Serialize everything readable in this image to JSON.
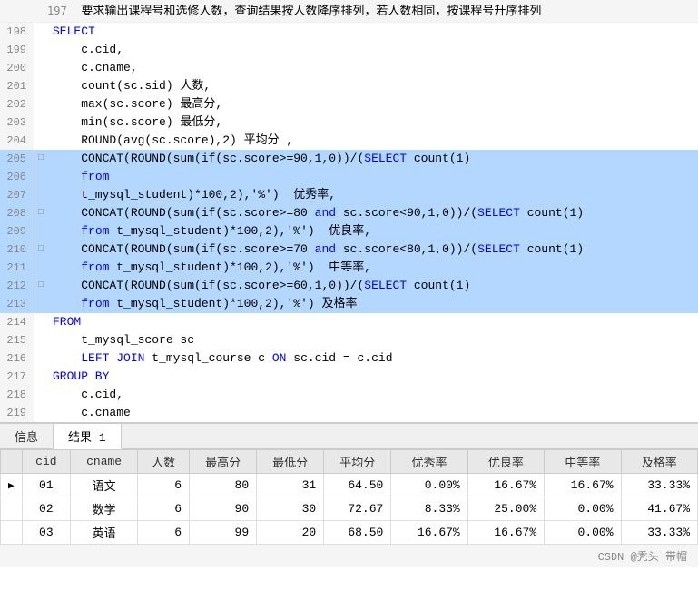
{
  "intro": {
    "text": "要求输出课程号和选修人数，查询结果按人数降序排列，若人数相同，按课程号升序排列",
    "lineNum": "197"
  },
  "codeLines": [
    {
      "num": 198,
      "fold": "",
      "highlighted": false,
      "tokens": [
        {
          "t": "SELECT",
          "c": "kw"
        }
      ]
    },
    {
      "num": 199,
      "fold": "",
      "highlighted": false,
      "tokens": [
        {
          "t": "    c.cid,",
          "c": "plain"
        }
      ]
    },
    {
      "num": 200,
      "fold": "",
      "highlighted": false,
      "tokens": [
        {
          "t": "    c.cname,",
          "c": "plain"
        }
      ]
    },
    {
      "num": 201,
      "fold": "",
      "highlighted": false,
      "tokens": [
        {
          "t": "    count(sc.sid) 人数,",
          "c": "plain"
        }
      ]
    },
    {
      "num": 202,
      "fold": "",
      "highlighted": false,
      "tokens": [
        {
          "t": "    max(sc.score) 最高分,",
          "c": "plain"
        }
      ]
    },
    {
      "num": 203,
      "fold": "",
      "highlighted": false,
      "tokens": [
        {
          "t": "    min(sc.score) 最低分,",
          "c": "plain"
        }
      ]
    },
    {
      "num": 204,
      "fold": "",
      "highlighted": false,
      "tokens": [
        {
          "t": "    ROUND(avg(sc.score),2) 平均分 ,",
          "c": "plain"
        }
      ]
    },
    {
      "num": 205,
      "fold": "□",
      "highlighted": true,
      "tokens": [
        {
          "t": "    CONCAT(ROUND(sum(if(sc.score>=90,1,0))/(",
          "c": "plain"
        },
        {
          "t": "SELECT",
          "c": "kw"
        },
        {
          "t": " count(1)",
          "c": "plain"
        }
      ]
    },
    {
      "num": 206,
      "fold": "",
      "highlighted": true,
      "tokens": [
        {
          "t": "    ",
          "c": "plain"
        },
        {
          "t": "from",
          "c": "kw"
        },
        {
          "t": "",
          "c": "plain"
        }
      ]
    },
    {
      "num": 207,
      "fold": "",
      "highlighted": true,
      "tokens": [
        {
          "t": "    t_mysql_student)*100,2),'%')  优秀率,",
          "c": "plain"
        }
      ]
    },
    {
      "num": 208,
      "fold": "□",
      "highlighted": true,
      "tokens": [
        {
          "t": "    CONCAT(ROUND(sum(if(sc.score>=80 ",
          "c": "plain"
        },
        {
          "t": "and",
          "c": "kw"
        },
        {
          "t": " sc.score<90,1,0))/(",
          "c": "plain"
        },
        {
          "t": "SELECT",
          "c": "kw"
        },
        {
          "t": " count(1)",
          "c": "plain"
        }
      ]
    },
    {
      "num": 209,
      "fold": "",
      "highlighted": true,
      "tokens": [
        {
          "t": "    ",
          "c": "plain"
        },
        {
          "t": "from",
          "c": "kw"
        },
        {
          "t": " t_mysql_student)*100,2),'%')  优良率,",
          "c": "plain"
        }
      ]
    },
    {
      "num": 210,
      "fold": "□",
      "highlighted": true,
      "tokens": [
        {
          "t": "    CONCAT(ROUND(sum(if(sc.score>=70 ",
          "c": "plain"
        },
        {
          "t": "and",
          "c": "kw"
        },
        {
          "t": " sc.score<80,1,0))/(",
          "c": "plain"
        },
        {
          "t": "SELECT",
          "c": "kw"
        },
        {
          "t": " count(1)",
          "c": "plain"
        }
      ]
    },
    {
      "num": 211,
      "fold": "",
      "highlighted": true,
      "tokens": [
        {
          "t": "    ",
          "c": "plain"
        },
        {
          "t": "from",
          "c": "kw"
        },
        {
          "t": " t_mysql_student)*100,2),'%')  中等率,",
          "c": "plain"
        }
      ]
    },
    {
      "num": 212,
      "fold": "□",
      "highlighted": true,
      "tokens": [
        {
          "t": "    CONCAT(ROUND(sum(if(sc.score>=60,1,0))/(",
          "c": "plain"
        },
        {
          "t": "SELECT",
          "c": "kw"
        },
        {
          "t": " count(1)",
          "c": "plain"
        }
      ]
    },
    {
      "num": 213,
      "fold": "",
      "highlighted": true,
      "tokens": [
        {
          "t": "    ",
          "c": "plain"
        },
        {
          "t": "from",
          "c": "kw"
        },
        {
          "t": " t_mysql_student)*100,2),'%') 及格率",
          "c": "plain"
        }
      ]
    },
    {
      "num": 214,
      "fold": "",
      "highlighted": false,
      "tokens": [
        {
          "t": "FROM",
          "c": "kw"
        }
      ]
    },
    {
      "num": 215,
      "fold": "",
      "highlighted": false,
      "tokens": [
        {
          "t": "    t_mysql_score sc",
          "c": "plain"
        }
      ]
    },
    {
      "num": 216,
      "fold": "",
      "highlighted": false,
      "tokens": [
        {
          "t": "    ",
          "c": "plain"
        },
        {
          "t": "LEFT JOIN",
          "c": "kw"
        },
        {
          "t": " t_mysql_course c ",
          "c": "plain"
        },
        {
          "t": "ON",
          "c": "kw"
        },
        {
          "t": " sc.cid = c.cid",
          "c": "plain"
        }
      ]
    },
    {
      "num": 217,
      "fold": "",
      "highlighted": false,
      "tokens": [
        {
          "t": "GROUP BY",
          "c": "kw"
        }
      ]
    },
    {
      "num": 218,
      "fold": "",
      "highlighted": false,
      "tokens": [
        {
          "t": "    c.cid,",
          "c": "plain"
        }
      ]
    },
    {
      "num": 219,
      "fold": "",
      "highlighted": false,
      "tokens": [
        {
          "t": "    c.cname",
          "c": "plain"
        }
      ]
    }
  ],
  "bottomPanel": {
    "tabs": [
      {
        "label": "信息",
        "active": false
      },
      {
        "label": "结果 1",
        "active": true
      }
    ]
  },
  "resultTable": {
    "headers": [
      "cid",
      "cname",
      "人数",
      "最高分",
      "最低分",
      "平均分",
      "优秀率",
      "优良率",
      "中等率",
      "及格率"
    ],
    "rows": [
      {
        "indicator": "▶",
        "cells": [
          "01",
          "语文",
          "6",
          "80",
          "31",
          "64.50",
          "0.00%",
          "16.67%",
          "16.67%",
          "33.33%"
        ]
      },
      {
        "indicator": "",
        "cells": [
          "02",
          "数学",
          "6",
          "90",
          "30",
          "72.67",
          "8.33%",
          "25.00%",
          "0.00%",
          "41.67%"
        ]
      },
      {
        "indicator": "",
        "cells": [
          "03",
          "英语",
          "6",
          "99",
          "20",
          "68.50",
          "16.67%",
          "16.67%",
          "0.00%",
          "33.33%"
        ]
      }
    ]
  },
  "watermark": {
    "text": "CSDN @秃头 带帽"
  }
}
